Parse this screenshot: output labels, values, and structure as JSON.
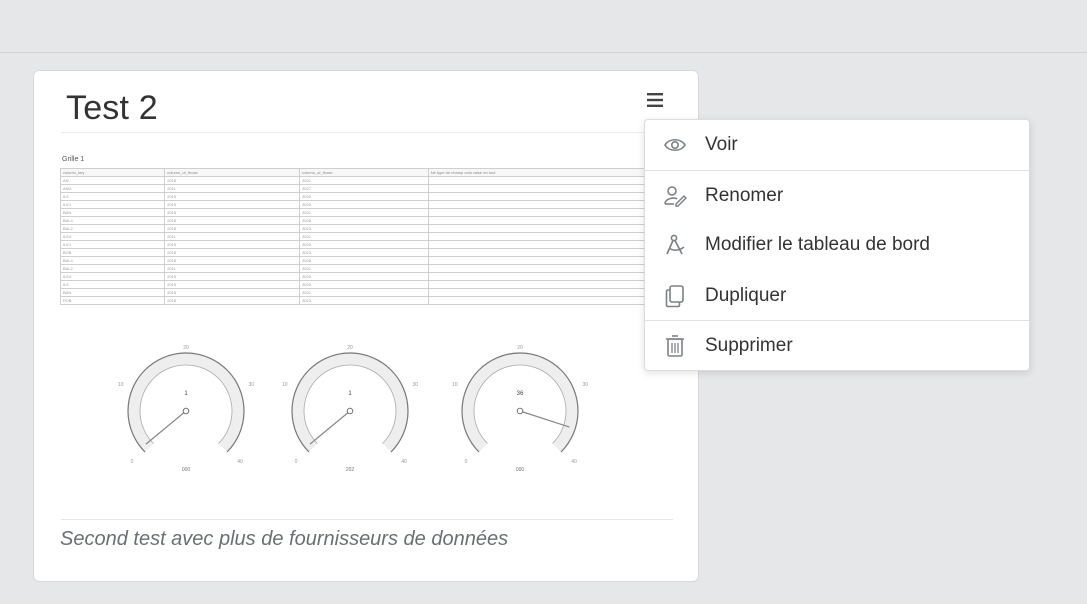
{
  "card": {
    "title": "Test 2",
    "description": "Second test avec plus de fournisseurs de données",
    "menu_icon": "hamburger-icon"
  },
  "preview": {
    "grid_title": "Grille 1",
    "table_headers": [
      "column_key",
      "column_of_those",
      "column_of_those",
      "Ne type de champ cela vaise en tout"
    ],
    "table_rows": [
      [
        "AN",
        "2018",
        "2021",
        ""
      ],
      [
        "ANG",
        "2011",
        "2027",
        ""
      ],
      [
        "ILE",
        "2019",
        "2020",
        ""
      ],
      [
        "ILE1",
        "2019",
        "2025",
        ""
      ],
      [
        "BAN",
        "2015",
        "2021",
        ""
      ],
      [
        "BAL4",
        "2018",
        "2028",
        ""
      ],
      [
        "BAL2",
        "2018",
        "2023",
        ""
      ],
      [
        "ILE4",
        "2011",
        "2021",
        ""
      ],
      [
        "ILE1",
        "2019",
        "2025",
        ""
      ],
      [
        "BOB",
        "2018",
        "2023",
        ""
      ],
      [
        "BAL4",
        "2018",
        "2028",
        ""
      ],
      [
        "BAL2",
        "2011",
        "2021",
        ""
      ],
      [
        "ILE4",
        "2019",
        "2025",
        ""
      ],
      [
        "ILE",
        "2019",
        "2025",
        ""
      ],
      [
        "BAN",
        "2015",
        "2021",
        ""
      ],
      [
        "POB",
        "2018",
        "2023",
        ""
      ]
    ],
    "gauges": [
      {
        "min_label": "0",
        "max_label": "40",
        "left_label": "10",
        "right_label": "30",
        "top_label": "20",
        "value": "1",
        "value_fraction": 0.02,
        "bottom_label": "000"
      },
      {
        "min_label": "0",
        "max_label": "40",
        "left_label": "10",
        "right_label": "30",
        "top_label": "20",
        "value": "1",
        "value_fraction": 0.02,
        "bottom_label": "202"
      },
      {
        "min_label": "0",
        "max_label": "40",
        "left_label": "10",
        "right_label": "30",
        "top_label": "20",
        "value": "36",
        "value_fraction": 0.9,
        "bottom_label": "000"
      }
    ]
  },
  "menu": {
    "items": [
      {
        "label": "Voir",
        "icon": "eye-icon"
      },
      {
        "label": "Renomer",
        "icon": "user-edit-icon"
      },
      {
        "label": "Modifier le tableau de bord",
        "icon": "compass-drafting-icon"
      },
      {
        "label": "Dupliquer",
        "icon": "copy-icon"
      },
      {
        "label": "Supprimer",
        "icon": "trash-icon"
      }
    ]
  },
  "colors": {
    "background": "#e6e7e9",
    "card": "#ffffff",
    "text": "#333333",
    "muted": "#6b6f73",
    "icon": "#7d8287"
  }
}
